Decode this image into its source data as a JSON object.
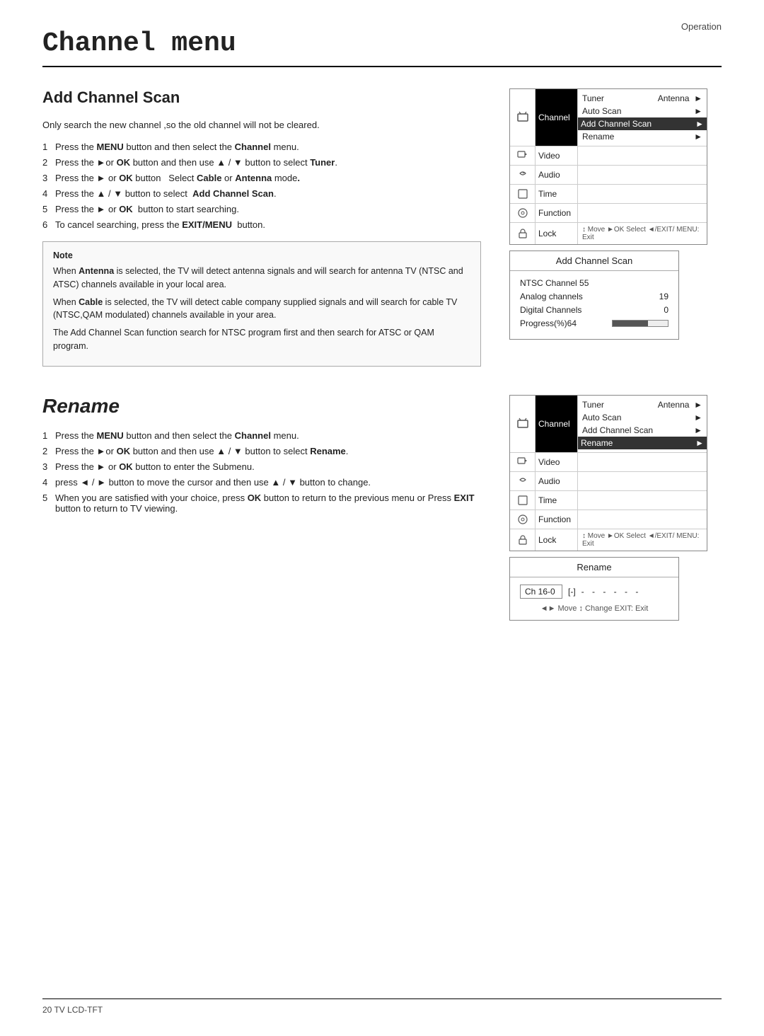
{
  "page": {
    "section": "Operation",
    "footer": "20  TV LCD-TFT"
  },
  "main_title": "Channel menu",
  "add_channel_scan": {
    "title": "Add Channel Scan",
    "intro": "Only search the new channel ,so the old channel will not be cleared.",
    "steps": [
      {
        "num": "1",
        "text": "Press the ",
        "bold1": "MENU",
        "mid1": " button and then select the ",
        "bold2": "Channel",
        "mid2": " menu.",
        "rest": ""
      },
      {
        "num": "2",
        "text": "Press the ►or ",
        "bold1": "OK",
        "mid1": " button and then use ▲ / ▼ button to select ",
        "bold2": "Tuner",
        "rest": "."
      },
      {
        "num": "3",
        "text": "Press the ► or ",
        "bold1": "OK",
        "mid1": " button  Select ",
        "bold2": "Cable",
        "mid2": " or ",
        "bold3": "Antenna",
        "rest": " mode."
      },
      {
        "num": "4",
        "text": "Press the ▲ / ▼ button to select  ",
        "bold1": "Add Channel Scan",
        "rest": "."
      },
      {
        "num": "5",
        "text": "Press the ► or ",
        "bold1": "OK",
        "mid1": "  button to start searching.",
        "rest": ""
      },
      {
        "num": "6",
        "text": "To cancel searching, press the ",
        "bold1": "EXIT/MENU",
        "rest": "  button."
      }
    ],
    "note_title": "Note",
    "note_paragraphs": [
      "When Antenna  is selected, the TV will detect antenna signals and will search for antenna TV (NTSC and ATSC) channels available in your local area.",
      "When Cable is selected, the TV will detect cable company supplied signals and will search for cable TV (NTSC,QAM modulated) channels available in your area.",
      "The Add Channel Scan function search for NTSC program first and then search for ATSC or QAM program."
    ],
    "menu": {
      "items": [
        {
          "label": "Channel",
          "active": true
        },
        {
          "label": "Video"
        },
        {
          "label": "Audio"
        },
        {
          "label": "Time"
        },
        {
          "label": "Function"
        },
        {
          "label": "Lock"
        }
      ],
      "channel_items": [
        {
          "text": "Tuner",
          "right": "Antenna",
          "arrow": "►"
        },
        {
          "text": "Auto Scan",
          "arrow": "►"
        },
        {
          "text": "Add Channel Scan",
          "arrow": "►",
          "highlighted": true
        },
        {
          "text": "Rename",
          "arrow": "►"
        }
      ],
      "hint": "↕ Move  ►OK Select  ◄/EXIT/ MENU: Exit"
    },
    "scan_popup": {
      "title": "Add Channel Scan",
      "rows": [
        {
          "label": "NTSC Channel 55",
          "value": ""
        },
        {
          "label": "Analog channels",
          "value": "19"
        },
        {
          "label": "Digital Channels",
          "value": "0"
        },
        {
          "label": "Progress(%)64",
          "value": "",
          "progress": 64
        }
      ]
    }
  },
  "rename": {
    "title": "Rename",
    "steps": [
      {
        "num": "1",
        "text": "Press the ",
        "bold1": "MENU",
        "mid1": " button and then select the ",
        "bold2": "Channel",
        "rest": " menu."
      },
      {
        "num": "2",
        "text": "Press the ►or ",
        "bold1": "OK",
        "mid1": " button and then use ▲ / ▼ button to select ",
        "bold2": "Rename",
        "rest": "."
      },
      {
        "num": "3",
        "text": "Press the ► or ",
        "bold1": "OK",
        "mid1": " button to enter the Submenu.",
        "rest": ""
      },
      {
        "num": "4",
        "text": "press ◄ / ► button to move the cursor and then use ▲ / ▼ button to change.",
        "rest": ""
      },
      {
        "num": "5",
        "text": "When you are satisfied with your choice,  press ",
        "bold1": "OK",
        "mid1": " button to return to the previous menu or Press ",
        "bold2": "EXIT",
        "rest": " button to return to TV viewing."
      }
    ],
    "menu": {
      "channel_items": [
        {
          "text": "Tuner",
          "right": "Antenna",
          "arrow": "►"
        },
        {
          "text": "Auto Scan",
          "arrow": "►"
        },
        {
          "text": "Add Channel Scan",
          "arrow": "►"
        },
        {
          "text": "Rename",
          "arrow": "►",
          "highlighted": true
        }
      ],
      "hint": "↕ Move  ►OK Select  ◄/EXIT/ MENU: Exit"
    },
    "popup": {
      "title": "Rename",
      "input_value": "Ch 16-0",
      "dashes": "- - - - - -",
      "hint": "◄► Move  ↕ Change  EXIT: Exit"
    }
  },
  "icons": {
    "channel_icon": "⊙",
    "video_icon": "▣",
    "audio_icon": "♪",
    "time_icon": "□",
    "function_icon": "⊕",
    "lock_icon": "△"
  }
}
